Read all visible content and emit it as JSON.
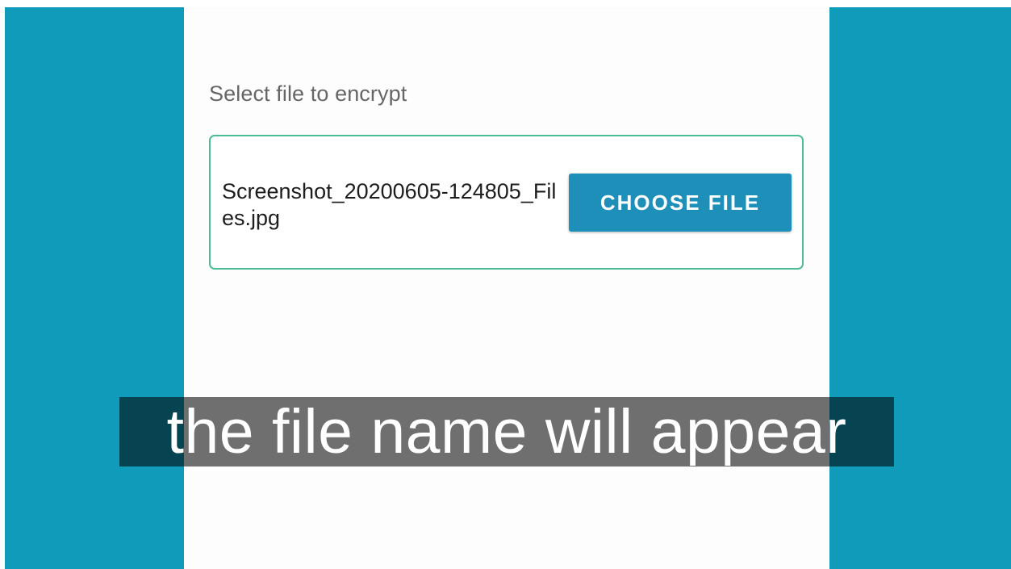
{
  "screen": {
    "section_label": "Select file to encrypt",
    "file_name": "Screenshot_20200605-124805_Files.jpg",
    "choose_file_label": "CHOOSE FILE"
  },
  "caption": {
    "text": "the file name will appear"
  },
  "colors": {
    "side_background": "#119bbb",
    "button": "#1e8fb8",
    "card_border": "#4dbb98"
  }
}
